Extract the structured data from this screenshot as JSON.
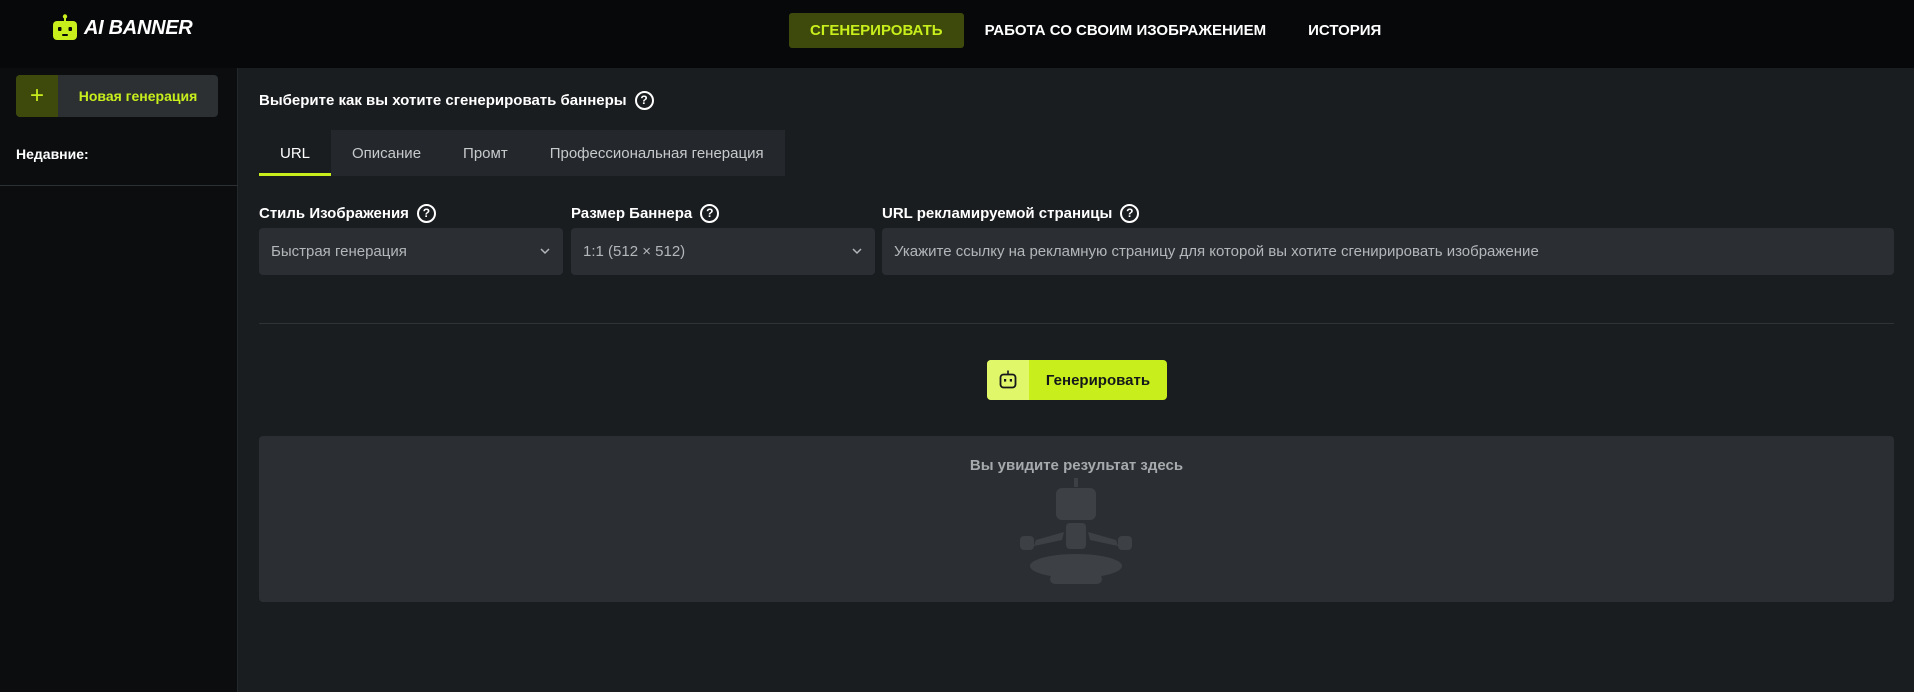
{
  "app": {
    "name": "AI BANNER"
  },
  "nav": {
    "items": [
      {
        "label": "СГЕНЕРИРОВАТЬ",
        "active": true
      },
      {
        "label": "РАБОТА СО СВОИМ ИЗОБРАЖЕНИЕМ",
        "active": false
      },
      {
        "label": "ИСТОРИЯ",
        "active": false
      }
    ]
  },
  "sidebar": {
    "new_button": "Новая генерация",
    "recent_label": "Недавние:"
  },
  "main": {
    "heading": "Выберите как вы хотите сгенерировать баннеры",
    "tabs": [
      {
        "label": "URL",
        "active": true
      },
      {
        "label": "Описание",
        "active": false
      },
      {
        "label": "Промт",
        "active": false
      },
      {
        "label": "Профессиональная генерация",
        "active": false
      }
    ],
    "style": {
      "label": "Стиль Изображения",
      "value": "Быстрая генерация"
    },
    "size": {
      "label": "Размер Баннера",
      "value": "1:1 (512 × 512)"
    },
    "url": {
      "label": "URL рекламируемой страницы",
      "placeholder": "Укажите ссылку на рекламную страницу для которой вы хотите сгенирировать изображение"
    },
    "generate_button": "Генерировать",
    "result_text": "Вы увидите результат здесь"
  },
  "colors": {
    "accent": "#c8ee1c",
    "accent_dark": "#3d4a0b",
    "background": "#1a1d20",
    "sidebar": "#0b0d0f",
    "topbar": "#060809",
    "field": "#2b2f33"
  }
}
